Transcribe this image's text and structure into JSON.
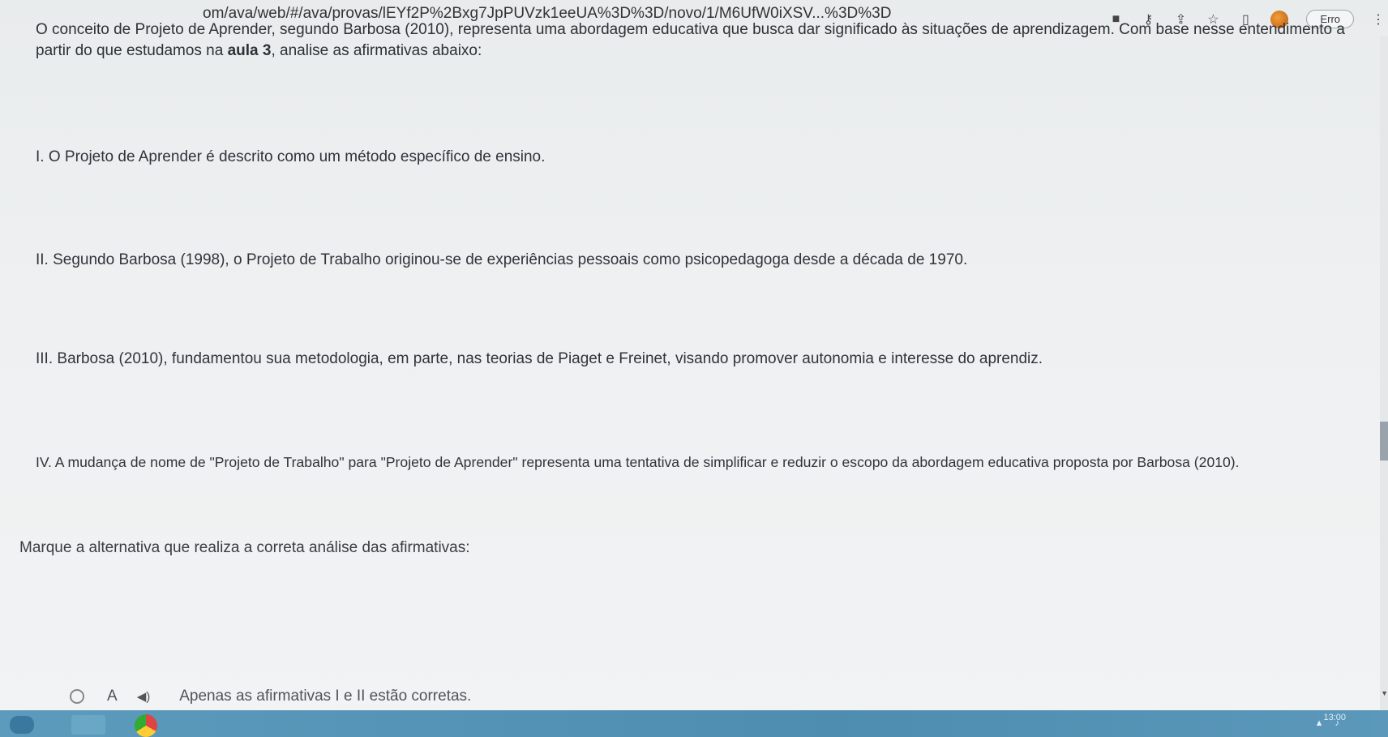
{
  "browser": {
    "url": "om/ava/web/#/ava/provas/lEYf2P%2Bxg7JpPUVzk1eeUA%3D%3D/novo/1/M6UfW0iXSV...%3D%3D",
    "error_label": "Erro"
  },
  "question": {
    "intro_lead": "O conceito de Projeto de Aprender, segundo Barbosa (2010), representa uma abordagem educativa que busca dar significado às situações de aprendizagem. Com base nesse entendimento a partir do que estudamos na ",
    "intro_bold": "aula 3",
    "intro_tail": ", analise as afirmativas abaixo:",
    "statements": [
      "I. O Projeto de Aprender é descrito como um método específico de ensino.",
      "II. Segundo Barbosa (1998), o Projeto de Trabalho originou-se de experiências pessoais como psicopedagoga desde a década de 1970.",
      "III. Barbosa (2010), fundamentou sua metodologia, em parte, nas teorias de Piaget e Freinet, visando promover autonomia e interesse do aprendiz.",
      "IV. A mudança de nome de \"Projeto de Trabalho\" para \"Projeto de Aprender\" representa uma tentativa de simplificar e reduzir o escopo da abordagem educativa proposta por Barbosa (2010)."
    ],
    "prompt": "Marque a alternativa que realiza a correta análise das afirmativas:",
    "options": [
      {
        "letter": "A",
        "text": "Apenas as afirmativas I e II estão corretas."
      }
    ]
  },
  "taskbar": {
    "clock": "13:00"
  }
}
